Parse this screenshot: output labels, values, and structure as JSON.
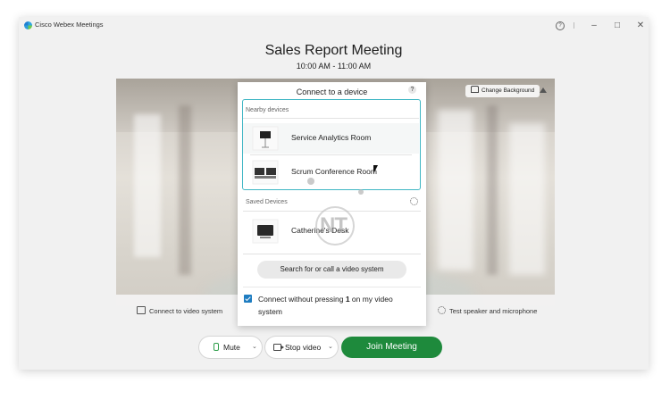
{
  "window": {
    "app_title": "Cisco Webex Meetings",
    "help_symbol": "?",
    "minimize_symbol": "–",
    "maximize_symbol": "□",
    "close_symbol": "✕"
  },
  "meeting": {
    "title": "Sales Report Meeting",
    "time": "10:00 AM - 11:00 AM"
  },
  "preview": {
    "change_background_label": "Change Background",
    "connect_video_system_label": "Connect to video system",
    "test_speaker_label": "Test speaker and microphone"
  },
  "device_popup": {
    "title": "Connect to a device",
    "help_symbol": "?",
    "nearby_label": "Nearby devices",
    "nearby_devices": [
      {
        "name": "Service Analytics Room"
      },
      {
        "name": "Scrum Conference Room"
      }
    ],
    "saved_label": "Saved Devices",
    "saved_devices": [
      {
        "name": "Catherine's Desk"
      }
    ],
    "search_button_label": "Search for or call a video system",
    "checkbox_checked": true,
    "checkbox_text_before": "Connect without pressing ",
    "checkbox_text_bold": "1",
    "checkbox_text_after": " on my video system"
  },
  "watermark": {
    "text": "NT"
  },
  "controls": {
    "mute_label": "Mute",
    "stop_video_label": "Stop video",
    "join_label": "Join Meeting",
    "chevron_symbol": "⌄"
  },
  "colors": {
    "join_green": "#1e8a3c",
    "highlight_teal": "#3fb6c4",
    "checkbox_blue": "#1f7dc1"
  },
  "icons": [
    "webex-logo-icon",
    "help-icon",
    "mic-icon",
    "camera-icon",
    "gear-icon",
    "cast-icon",
    "change-background-icon",
    "cursor-icon"
  ]
}
